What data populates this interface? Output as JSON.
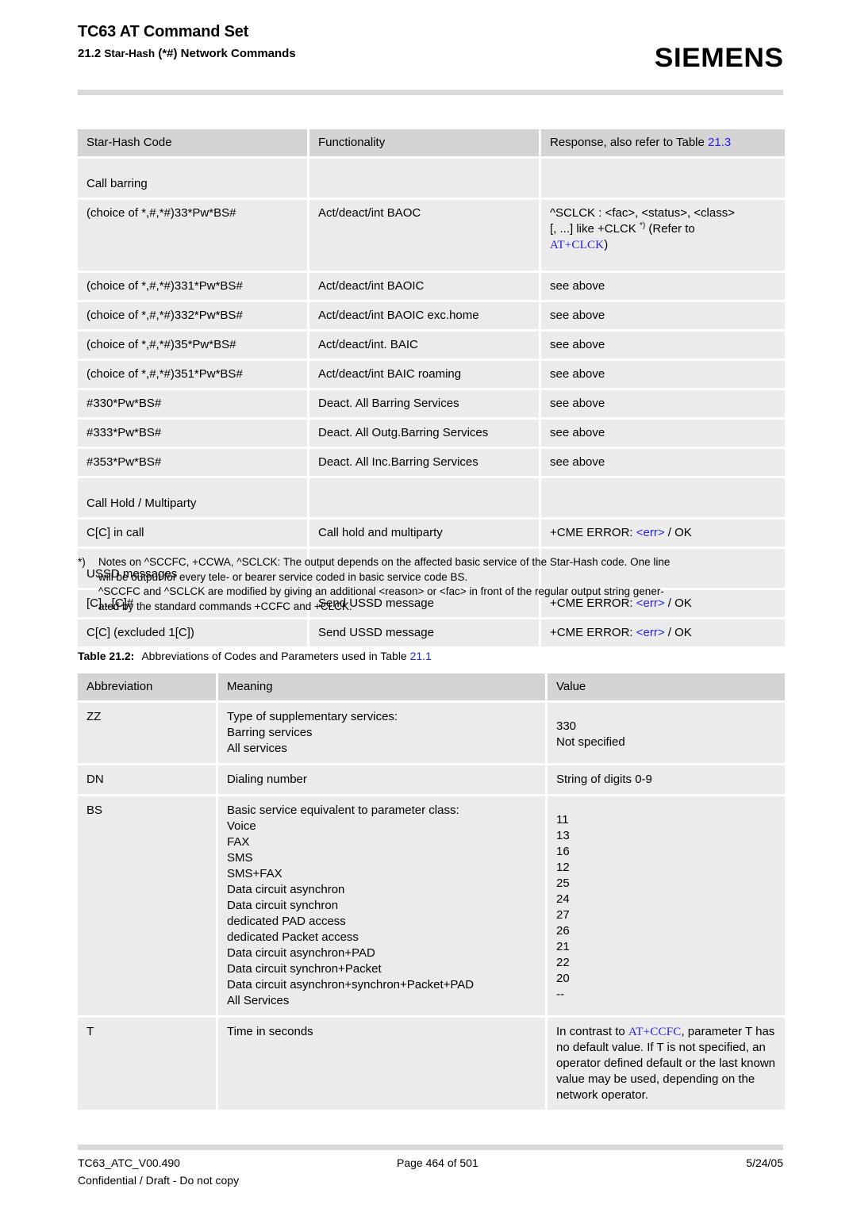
{
  "header": {
    "title": "TC63 AT Command Set",
    "subtitle_prefix": "21.2 ",
    "subtitle_starhash": "Star-Hash",
    "subtitle_suffix": " (*#) Network Commands",
    "brand": "SIEMENS"
  },
  "table_starhash": {
    "columns": [
      "Star-Hash Code",
      "Functionality",
      "Response, also refer to Table "
    ],
    "columns_ref": "21.3",
    "sections": [
      {
        "label": "Call barring"
      },
      {
        "label": "Call Hold / Multiparty"
      },
      {
        "label": "USSD messages"
      }
    ],
    "rows": [
      {
        "code": "(choice of *,#,*#)33*Pw*BS#",
        "functionality": "Act/deact/int BAOC",
        "response_l1": "^SCLCK : <fac>, <status>, <class>",
        "response_l2a": "[, ...] like +CLCK ",
        "response_l2_sup": "*)",
        "response_l2b": " (Refer to",
        "response_l3_link": "AT+CLCK",
        "response_l3_tail": ")"
      },
      {
        "code": "(choice of *,#,*#)331*Pw*BS#",
        "functionality": "Act/deact/int BAOIC",
        "response": "see above"
      },
      {
        "code": "(choice of *,#,*#)332*Pw*BS#",
        "functionality": "Act/deact/int BAOIC exc.home",
        "response": "see above"
      },
      {
        "code": "(choice of *,#,*#)35*Pw*BS#",
        "functionality": "Act/deact/int. BAIC",
        "response": "see above"
      },
      {
        "code": "(choice of *,#,*#)351*Pw*BS#",
        "functionality": "Act/deact/int BAIC roaming",
        "response": "see above"
      },
      {
        "code": "#330*Pw*BS#",
        "functionality": "Deact. All Barring Services",
        "response": "see above"
      },
      {
        "code": "#333*Pw*BS#",
        "functionality": "Deact. All Outg.Barring Services",
        "response": "see above"
      },
      {
        "code": "#353*Pw*BS#",
        "functionality": "Deact. All Inc.Barring Services",
        "response": "see above"
      },
      {
        "code": "C[C] in call",
        "functionality": "Call hold and multiparty",
        "response_prefix": "+CME ERROR: ",
        "response_err": "<err>",
        "response_suffix": " / OK"
      },
      {
        "code": "[C]...[C]#",
        "functionality": "Send USSD message",
        "response_prefix": "+CME ERROR: ",
        "response_err": "<err>",
        "response_suffix": " / OK"
      },
      {
        "code": "C[C] (excluded 1[C])",
        "functionality": "Send USSD message",
        "response_prefix": "+CME ERROR: ",
        "response_err": "<err>",
        "response_suffix": " / OK"
      }
    ]
  },
  "footnote": {
    "marker": "*)",
    "line1": "Notes on ^SCCFC, +CCWA, ^SCLCK: The output depends on the affected basic service of the Star-Hash code. One line",
    "line2": "will be output for every tele- or bearer service coded in basic service code BS.",
    "line3": "^SCCFC and ^SCLCK are modified by giving an additional <reason> or <fac> in front of the regular output string gener-",
    "line4": "ated by the standard commands +CCFC and +CLCK."
  },
  "table_caption": {
    "label": "Table 21.2:",
    "text": "Abbreviations of Codes and Parameters used in Table ",
    "ref": "21.1"
  },
  "table_abbrev": {
    "columns": [
      "Abbreviation",
      "Meaning",
      "Value"
    ],
    "rows": [
      {
        "abbreviation": "ZZ",
        "meaning_lines": [
          "Type of supplementary services:",
          "Barring services",
          "All services"
        ],
        "value_lines": [
          "",
          "330",
          "Not specified"
        ]
      },
      {
        "abbreviation": "DN",
        "meaning_lines": [
          "Dialing number"
        ],
        "value_lines": [
          "String of digits 0-9"
        ]
      },
      {
        "abbreviation": "BS",
        "meaning_lines": [
          "Basic service equivalent to parameter class:",
          "Voice",
          "FAX",
          "SMS",
          "SMS+FAX",
          "Data circuit asynchron",
          "Data circuit synchron",
          "dedicated PAD access",
          "dedicated Packet access",
          "Data circuit asynchron+PAD",
          "Data circuit synchron+Packet",
          "Data circuit asynchron+synchron+Packet+PAD",
          "All Services"
        ],
        "value_lines": [
          "",
          "11",
          "13",
          "16",
          "12",
          "25",
          "24",
          "27",
          "26",
          "21",
          "22",
          "20",
          "--"
        ]
      },
      {
        "abbreviation": "T",
        "meaning_lines": [
          "Time in seconds"
        ],
        "value_rich": {
          "prefix": "In contrast to ",
          "link": "AT+CCFC",
          "suffix": ", parameter T has no default value. If T is not specified, an operator defined default or the last known value may be used, depending on the network operator."
        }
      }
    ]
  },
  "footer": {
    "doc_id": "TC63_ATC_V00.490",
    "page": "Page 464 of 501",
    "date": "5/24/05",
    "confidential": "Confidential / Draft - Do not copy"
  },
  "colors": {
    "link": "#2323e6",
    "header_band": "#d4d4d4",
    "cell_band": "#ebebeb",
    "rule": "#d9d9d9"
  }
}
